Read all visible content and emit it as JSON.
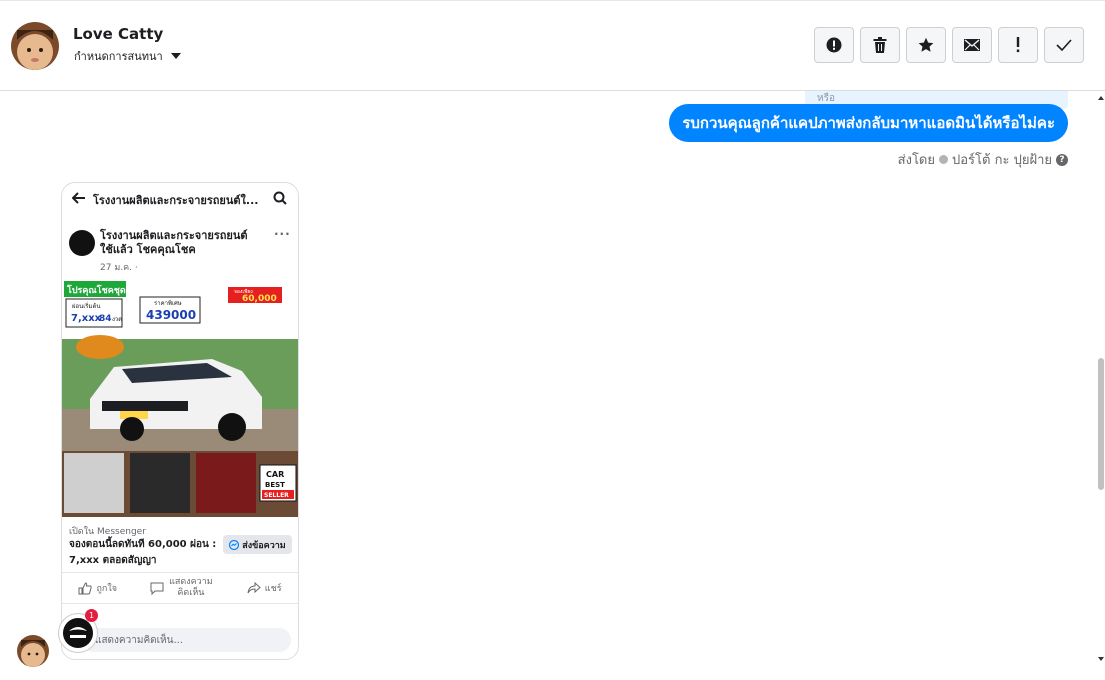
{
  "header": {
    "contact_name": "Love Catty",
    "assign_label": "กำหนดการสนทนา",
    "actions": [
      {
        "name": "report-spam-button",
        "icon": "alert-circle-icon"
      },
      {
        "name": "delete-button",
        "icon": "trash-icon"
      },
      {
        "name": "star-button",
        "icon": "star-icon"
      },
      {
        "name": "mark-unread-button",
        "icon": "envelope-icon"
      },
      {
        "name": "important-button",
        "icon": "exclamation-icon"
      },
      {
        "name": "mark-done-button",
        "icon": "check-icon"
      }
    ]
  },
  "conversation": {
    "prev_bubble_text": "หรือ",
    "outgoing_message": "รบกวนคุณลูกค้าแคปภาพส่งกลับมาหาแอดมินได้หรือไม่คะ",
    "sent_by_label": "ส่งโดย",
    "sent_by_name": "ปอร์โต้ กะ ปุยฝ้าย",
    "help_glyph": "?"
  },
  "shared_screenshot": {
    "page_title": "โรงงานผลิตและกระจายรถยนต์ใ...",
    "post_title": "โรงงานผลิตและกระจายรถยนต์ใช้แล้ว โชคคุณโชค",
    "post_date": "27 ม.ค. ·",
    "more_glyph": "···",
    "ad": {
      "promo": "โปรคุณโชคชุดนี้",
      "monthly": "ผ่อนเริ่มต้น",
      "installment": "7,xxx",
      "term": "84",
      "term_unit": "งวด",
      "price_label": "ราคาพิเศษ",
      "price": "439000",
      "down_label": "จองเพียง",
      "down": "60,000",
      "car_label": "CAR",
      "best_label": "BEST",
      "seller_label": "SELLER"
    },
    "messenger_link": "เปิดใน Messenger",
    "cta_text": "จองตอนนี้ลดทันที 60,000 ผ่อน : 7,xxx ตลอดสัญญา",
    "cta_button": "ส่งข้อความ",
    "like_label": "ถูกใจ",
    "comment_label": "แสดงความคิดเห็น",
    "share_label": "แชร์",
    "comment_placeholder": "แสดงความคิดเห็น...",
    "notification_count": "1"
  }
}
